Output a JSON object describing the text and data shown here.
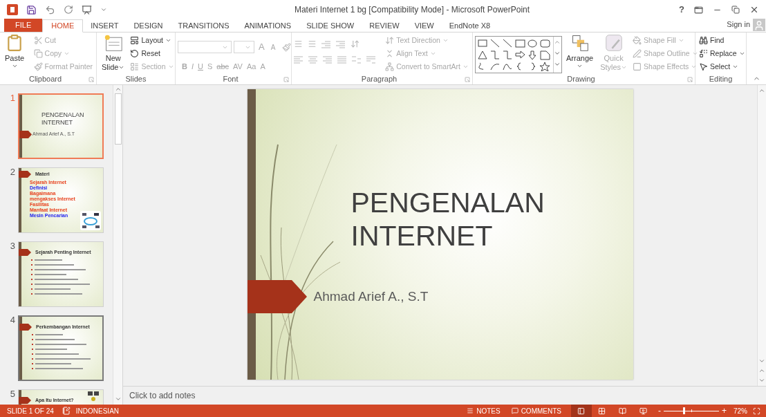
{
  "window": {
    "title": "Materi Internet 1 bg [Compatibility Mode] - Microsoft PowerPoint",
    "help": "?"
  },
  "tabs": [
    {
      "label": "FILE",
      "kind": "file",
      "selected": false
    },
    {
      "label": "HOME",
      "kind": "tab",
      "selected": true
    },
    {
      "label": "INSERT",
      "kind": "tab",
      "selected": false
    },
    {
      "label": "DESIGN",
      "kind": "tab",
      "selected": false
    },
    {
      "label": "TRANSITIONS",
      "kind": "tab",
      "selected": false
    },
    {
      "label": "ANIMATIONS",
      "kind": "tab",
      "selected": false
    },
    {
      "label": "SLIDE SHOW",
      "kind": "tab",
      "selected": false
    },
    {
      "label": "REVIEW",
      "kind": "tab",
      "selected": false
    },
    {
      "label": "VIEW",
      "kind": "tab",
      "selected": false
    },
    {
      "label": "EndNote X8",
      "kind": "tab",
      "selected": false
    }
  ],
  "sign_in": "Sign in",
  "ribbon": [
    {
      "name": "Clipboard",
      "launcher": true,
      "columns": [
        [
          {
            "kind": "large",
            "label": "Paste",
            "dropdown": true,
            "disabled": false
          }
        ],
        [
          {
            "kind": "small",
            "label": "Cut",
            "dropdown": false,
            "disabled": true
          },
          {
            "kind": "small",
            "label": "Copy",
            "dropdown": true,
            "disabled": true
          },
          {
            "kind": "small",
            "label": "Format Painter",
            "dropdown": false,
            "disabled": true
          }
        ]
      ]
    },
    {
      "name": "Slides",
      "launcher": false,
      "columns": [
        [
          {
            "kind": "large",
            "label": "New Slide",
            "dropdown": true,
            "disabled": false
          }
        ],
        [
          {
            "kind": "small",
            "label": "Layout",
            "dropdown": true,
            "disabled": false
          },
          {
            "kind": "small",
            "label": "Reset",
            "dropdown": false,
            "disabled": false
          },
          {
            "kind": "small",
            "label": "Section",
            "dropdown": true,
            "disabled": true
          }
        ]
      ]
    },
    {
      "name": "Font",
      "launcher": true,
      "columns": [
        [
          {
            "kind": "font_fields",
            "symbols": [
              "A",
              "A"
            ],
            "disabled": true
          },
          {
            "kind": "symbols",
            "symbols": [
              "B",
              "I",
              "U",
              "S",
              "abc",
              "AV",
              "Aa",
              "A"
            ],
            "disabled": true
          }
        ]
      ]
    },
    {
      "name": "Paragraph",
      "launcher": true,
      "columns": [
        [
          {
            "kind": "paragraph_icons",
            "disabled": true
          }
        ],
        [
          {
            "kind": "small",
            "label": "Text Direction",
            "dropdown": true,
            "disabled": true
          },
          {
            "kind": "small",
            "label": "Align Text",
            "dropdown": true,
            "disabled": true
          },
          {
            "kind": "small",
            "label": "Convert to SmartArt",
            "dropdown": true,
            "disabled": true
          }
        ]
      ]
    },
    {
      "name": "Drawing",
      "launcher": true,
      "columns": [
        [
          {
            "kind": "shape_gallery",
            "disabled": false
          }
        ],
        [
          {
            "kind": "large",
            "label": "Arrange",
            "dropdown": true,
            "disabled": false
          }
        ],
        [
          {
            "kind": "large",
            "label": "Quick Styles",
            "dropdown": true,
            "disabled": true
          }
        ],
        [
          {
            "kind": "small",
            "label": "Shape Fill",
            "dropdown": true,
            "disabled": true
          },
          {
            "kind": "small",
            "label": "Shape Outline",
            "dropdown": true,
            "disabled": true
          },
          {
            "kind": "small",
            "label": "Shape Effects",
            "dropdown": true,
            "disabled": true
          }
        ]
      ]
    },
    {
      "name": "Editing",
      "launcher": false,
      "columns": [
        [
          {
            "kind": "small",
            "label": "Find",
            "dropdown": false,
            "disabled": false
          },
          {
            "kind": "small",
            "label": "Replace",
            "dropdown": true,
            "disabled": false
          },
          {
            "kind": "small",
            "label": "Select",
            "dropdown": true,
            "disabled": false
          }
        ]
      ]
    }
  ],
  "slides": [
    {
      "number": "1",
      "selected": true,
      "hovered": false,
      "kind": "title",
      "title": "PENGENALAN INTERNET",
      "subtitle": "Ahmad Arief A., S.T"
    },
    {
      "number": "2",
      "selected": false,
      "hovered": false,
      "kind": "list",
      "title": "Materi",
      "bullets": [
        {
          "text": "Sejarah Internet",
          "color": "#e8401c"
        },
        {
          "text": "Definisi",
          "color": "#1c1cf0"
        },
        {
          "text": "Bagaimana mengakses Internet",
          "color": "#e8401c"
        },
        {
          "text": "Fasilitas",
          "color": "#e8401c"
        },
        {
          "text": "Manfaat Internet",
          "color": "#e8401c"
        },
        {
          "text": "Mesin Pencarian",
          "color": "#1c1cf0"
        }
      ]
    },
    {
      "number": "3",
      "selected": false,
      "hovered": false,
      "kind": "lines",
      "title": "Sejarah Penting Internet"
    },
    {
      "number": "4",
      "selected": false,
      "hovered": true,
      "kind": "lines",
      "title": "Perkembangan Internet"
    },
    {
      "number": "5",
      "selected": false,
      "hovered": false,
      "kind": "picture_title",
      "title": "Apa Itu Internet?"
    }
  ],
  "current_slide": {
    "title": "PENGENALAN INTERNET",
    "subtitle": "Ahmad Arief A., S.T"
  },
  "notes": {
    "placeholder": "Click to add notes"
  },
  "status_bar": {
    "slide": "SLIDE 1 OF 24",
    "language": "INDONESIAN",
    "notes": "NOTES",
    "comments": "COMMENTS",
    "views": [
      {
        "kind": "normal",
        "selected": true
      },
      {
        "kind": "sorter",
        "selected": false
      },
      {
        "kind": "reading",
        "selected": false
      },
      {
        "kind": "slideshow",
        "selected": false
      }
    ],
    "zoom": {
      "minus": "-",
      "plus": "+",
      "level": 0.36,
      "reading": "72%"
    }
  }
}
